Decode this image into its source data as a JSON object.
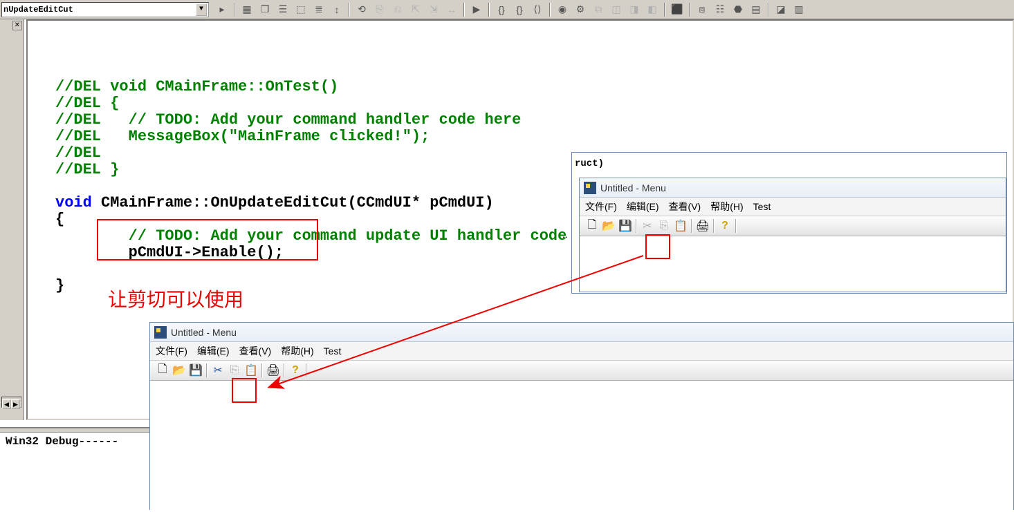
{
  "combo": {
    "value": "nUpdateEditCut"
  },
  "code": {
    "l1": "//DEL void CMainFrame::OnTest()",
    "l2": "//DEL {",
    "l3": "//DEL \t// TODO: Add your command handler code here",
    "l4": "//DEL \tMessageBox(\"MainFrame clicked!\");",
    "l5": "//DEL ",
    "l6": "//DEL }",
    "l7a": "void",
    "l7b": " CMainFrame::OnUpdateEditCut(CCmdUI* pCmdUI)",
    "l8": "{",
    "l9": "\t// TODO: Add your command update UI handler code here",
    "l10": "\tpCmdUI->Enable();",
    "l11": "\t",
    "l12": "}"
  },
  "annotation": "让剪切可以使用",
  "output": {
    "line": " Win32 Debug------"
  },
  "app": {
    "title": "Untitled - Menu",
    "menus": {
      "file": "文件(F)",
      "edit": "编辑(E)",
      "view": "查看(V)",
      "help": "帮助(H)",
      "test": "Test"
    }
  },
  "partial": {
    "ruct": "ruct)",
    "dots": ".."
  },
  "icons": {
    "new": "🗋",
    "open": "📂",
    "save": "💾",
    "cut": "✂",
    "copy": "⎘",
    "paste": "📋",
    "print": "🖨",
    "help": "?"
  },
  "toolbar_glyphs": [
    "▸",
    "▦",
    "❐",
    "☰",
    "⬚",
    "≣",
    "↕",
    "⟲",
    "⎘",
    "⎌",
    "⇱",
    "⇲",
    "↔",
    "{}",
    "{}",
    "⟨⟩",
    "◉",
    "⚙",
    "⧉",
    "◫",
    "◨",
    "◧",
    "⬛",
    "⧈",
    "☷",
    "⬣",
    "卐",
    "▤",
    "◪"
  ],
  "colors": {
    "red": "#e00",
    "green": "#008000",
    "blue": "#0000ff"
  }
}
